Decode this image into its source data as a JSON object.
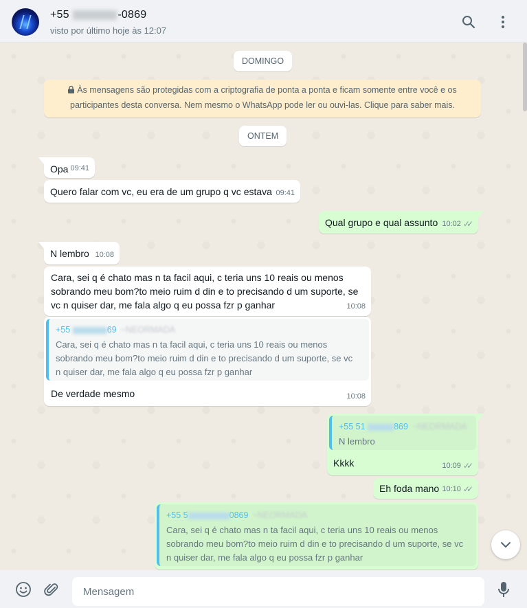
{
  "header": {
    "contact_prefix": "+55",
    "contact_suffix": "-0869",
    "status": "visto por último hoje às 12:07",
    "icons": {
      "search": "search-icon",
      "menu": "kebab-menu-icon"
    }
  },
  "chat": {
    "date_sunday": "DOMINGO",
    "encryption_notice": "Às mensagens são protegidas com a criptografia de ponta a ponta e ficam somente entre você e os participantes desta conversa. Nem mesmo o WhatsApp pode ler ou ouvi-las. Clique para saber mais.",
    "date_yesterday": "ONTEM",
    "messages": [
      {
        "text": "Opa",
        "time": "09:41"
      },
      {
        "text": "Quero falar com vc, eu era de um grupo q vc estava",
        "time": "09:41"
      },
      {
        "text": "Qual grupo e qual assunto",
        "time": "10:02"
      },
      {
        "text": "N lembro",
        "time": "10:08"
      },
      {
        "text": "Cara, sei q é chato mas n ta facil aqui, c teria uns 10 reais ou menos\nsobrando meu bom?to meio ruim d din e to precisando d um suporte, se\nvc n quiser dar, me fala algo q eu possa fzr p ganhar",
        "time": "10:08"
      },
      {
        "quote_author_prefix": "+55",
        "quote_author_suffix": "69",
        "quote_nick": "~NEORMADA",
        "quote_text": "Cara, sei q é chato mas n ta facil aqui, c teria uns 10 reais ou menos\nsobrando meu bom?to meio ruim d din e to precisando d um suporte, se vc\nn quiser dar, me fala algo q eu possa fzr p ganhar",
        "text": "De verdade mesmo",
        "time": "10:08"
      },
      {
        "quote_author_prefix": "+55 51",
        "quote_author_suffix": "869",
        "quote_nick": "~NEORMADA",
        "quote_text": "N lembro",
        "text": "Kkkk",
        "time": "10:09"
      },
      {
        "text": "Eh foda mano",
        "time": "10:10"
      },
      {
        "quote_author_prefix": "+55 5",
        "quote_author_suffix": "0869",
        "quote_nick": "~NEORMADA",
        "quote_text": "Cara, sei q é chato mas n ta facil aqui, c teria uns 10 reais ou menos\nsobrando meu bom?to meio ruim d din e to precisando d um suporte, se vc\nn quiser dar, me fala algo q eu possa fzr p ganhar"
      }
    ]
  },
  "footer": {
    "placeholder": "Mensagem",
    "icons": {
      "emoji": "emoji-icon",
      "attach": "paperclip-icon",
      "mic": "microphone-icon"
    }
  }
}
